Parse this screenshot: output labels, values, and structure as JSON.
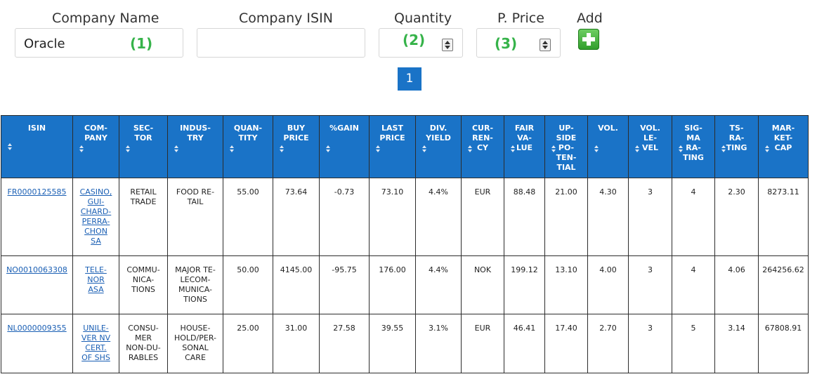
{
  "form": {
    "company_name": {
      "label": "Company Name",
      "value": "Oracle",
      "annotation": "(1)"
    },
    "company_isin": {
      "label": "Company ISIN",
      "value": ""
    },
    "quantity": {
      "label": "Quantity",
      "annotation": "(2)"
    },
    "price": {
      "label": "P. Price",
      "annotation": "(3)"
    },
    "add": {
      "label": "Add",
      "icon": "plus-icon",
      "color": "#36b34a"
    }
  },
  "pagination": {
    "current_page": "1",
    "color": "#1a73c7"
  },
  "table": {
    "header_color": "#1a73c7",
    "columns": [
      "ISIN",
      "COM-\nPANY",
      "SEC-\nTOR",
      "INDUS-\nTRY",
      "QUAN-\nTITY",
      "BUY\nPRICE",
      "%GAIN",
      "LAST\nPRICE",
      "DIV.\nYIELD",
      "CUR-\nREN-\nCY",
      "FAIR\nVA-\nLUE",
      "UP-\nSIDE\nPO-\nTEN-\nTIAL",
      "VOL.",
      "VOL.\nLE-\nVEL",
      "SIG-\nMA\nRA-\nTING",
      "TS-\nRA-\nTING",
      "MAR-\nKET-\nCAP"
    ],
    "rows": [
      [
        "FR0000125585",
        "CASINO,\nGUI-\nCHARD-\nPERRA-\nCHON\nSA",
        "RETAIL\nTRADE",
        "FOOD RE-\nTAIL",
        "55.00",
        "73.64",
        "-0.73",
        "73.10",
        "4.4%",
        "EUR",
        "88.48",
        "21.00",
        "4.30",
        "3",
        "4",
        "2.30",
        "8273.11"
      ],
      [
        "NO0010063308",
        "TELE-\nNOR\nASA",
        "COMMU-\nNICA-\nTIONS",
        "MAJOR TE-\nLECOM-\nMUNICA-\nTIONS",
        "50.00",
        "4145.00",
        "-95.75",
        "176.00",
        "4.4%",
        "NOK",
        "199.12",
        "13.10",
        "4.00",
        "3",
        "4",
        "4.06",
        "264256.62"
      ],
      [
        "NL0000009355",
        "UNILE-\nVER NV\nCERT.\nOF SHS",
        "CONSU-\nMER\nNON-DU-\nRABLES",
        "HOUSE-\nHOLD/PER-\nSONAL\nCARE",
        "25.00",
        "31.00",
        "27.58",
        "39.55",
        "3.1%",
        "EUR",
        "46.41",
        "17.40",
        "2.70",
        "3",
        "5",
        "3.14",
        "67808.91"
      ]
    ]
  }
}
